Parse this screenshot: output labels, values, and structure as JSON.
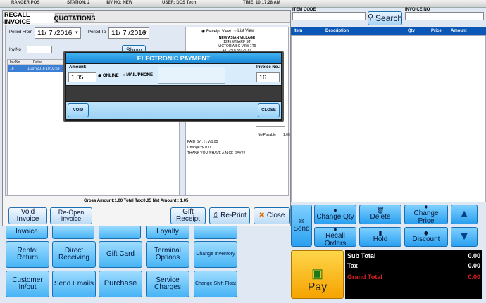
{
  "topbar": {
    "pos": "RANGER POS",
    "station": "STATION: 2",
    "inv": "INV NO: NEW",
    "user": "USER: DCS Tech",
    "time": "TIME: 10:17:28 AM"
  },
  "right": {
    "item_code_label": "ITEM CODE",
    "invoice_no_label": "INVOICE NO",
    "search_label": "Search",
    "cols": [
      "Item",
      "Description",
      "Qty",
      "Price",
      "Amount"
    ]
  },
  "actions": {
    "send": "Send",
    "change_qty": "Change Qty",
    "delete": "Delete",
    "change_price": "Change Price",
    "recall_orders": "Recall Orders",
    "hold": "Hold",
    "discount": "Discount",
    "pay": "Pay"
  },
  "totals": {
    "subtotal_label": "Sub Total",
    "subtotal": "0.00",
    "tax_label": "Tax",
    "tax": "0.00",
    "grand_label": "Grand Total",
    "grand": "0.00"
  },
  "left_buttons": {
    "invoice": "Invoice",
    "loyalty": "Loyalty",
    "rental_return": "Rental Return",
    "direct_receiving": "Direct Receiving",
    "gift_card": "Gift Card",
    "terminal_options": "Terminal Options",
    "change_inventory": "Change Inventory",
    "customer_inout": "Customer In/out",
    "send_emails": "Send Emails",
    "purchase": "Purchase",
    "service_charges": "Service Charges",
    "change_shift_float": "Change Shift Float"
  },
  "recall": {
    "tab1": "RECALL INVOICE",
    "tab2": "QUOTATIONS",
    "period_from_label": "Period From",
    "period_from": "11/ 7 /2016",
    "period_to_label": "Period To",
    "period_to": "11/ 7 /2016",
    "inv_no_label": "Inv.No",
    "show": "Show",
    "col_inv": "Inv No",
    "col_dated": "Dated",
    "row_inv": "16",
    "row_dated": "11/07/2016 10:03:59",
    "receipt_view": "Receipt View",
    "list_view": "List View",
    "store_name": "NEW ASIAN VILLAGE",
    "addr1": "1245 WHARF ST",
    "addr2": "VICTORIA BC V8W 1T9",
    "phone": "+1 (250) 381-8181",
    "net_payable_label": "NetPayable",
    "net_payable": "1.05",
    "paid_by": "PAID BY : | \\ V/1.05",
    "change": "Change: $0.00",
    "thanks": "THANK YOU !!!HAVE A NICE DAY !!!",
    "summary": "Gross Amount:1.00   Total Tax:0.05   Net Amount : 1.05",
    "void_invoice": "Void Invoice",
    "reopen_invoice": "Re-Open Invoice",
    "gift_receipt": "Gift Receipt",
    "reprint": "Re-Print",
    "close": "Close"
  },
  "payment": {
    "title": "ELECTRONIC PAYMENT",
    "amount_label": "Amount:",
    "amount": "1.05",
    "online": "ONLINE",
    "mail_phone": "MAIL/PHONE",
    "invoice_no_label": "Invoice No.:",
    "invoice_no": "16",
    "void": "VOID",
    "close": "CLOSE"
  }
}
